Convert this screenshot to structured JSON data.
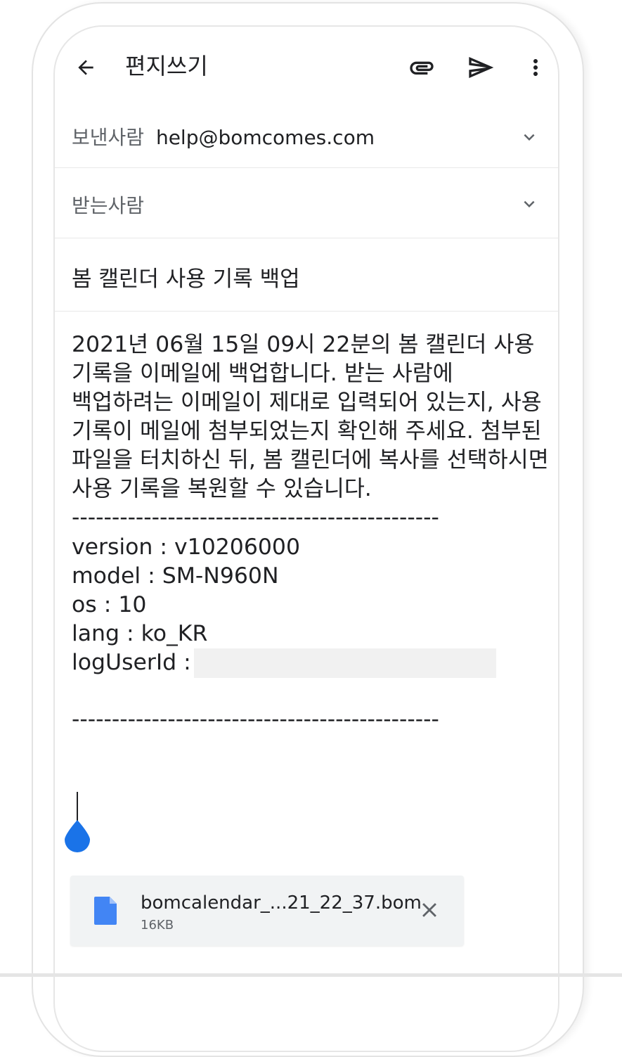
{
  "header": {
    "title": "편지쓰기",
    "icons": [
      "back-arrow-icon",
      "attachment-icon",
      "send-icon",
      "more-vert-icon"
    ]
  },
  "from": {
    "label": "보낸사람",
    "value": "help@bomcomes.com"
  },
  "to": {
    "label": "받는사람",
    "value": ""
  },
  "subject": "봄 캘린더 사용 기록 백업",
  "body": {
    "message": "2021년 06월 15일 09시 22분의 봄 캘린더 사용 기록을 이메일에 백업합니다. 받는 사람에 백업하려는 이메일이 제대로 입력되어 있는지, 사용 기록이 메일에 첨부되었는지 확인해 주세요. 첨부된 파일을 터치하신 뒤, 봄 캘린더에 복사를 선택하시면 사용 기록을 복원할 수 있습니다.",
    "separator": "----------------------------------------------",
    "version": "version : v10206000",
    "model": "model : SM-N960N",
    "os": "os : 10",
    "lang": "lang : ko_KR",
    "log_user_id_label": "logUserId :"
  },
  "attachment": {
    "name": "bomcalendar_...21_22_37.bom",
    "size": "16KB"
  },
  "colors": {
    "accent": "#1a73e8",
    "attachment_icon": "#4285f4",
    "text": "#202124",
    "secondary_text": "#5f6368"
  }
}
